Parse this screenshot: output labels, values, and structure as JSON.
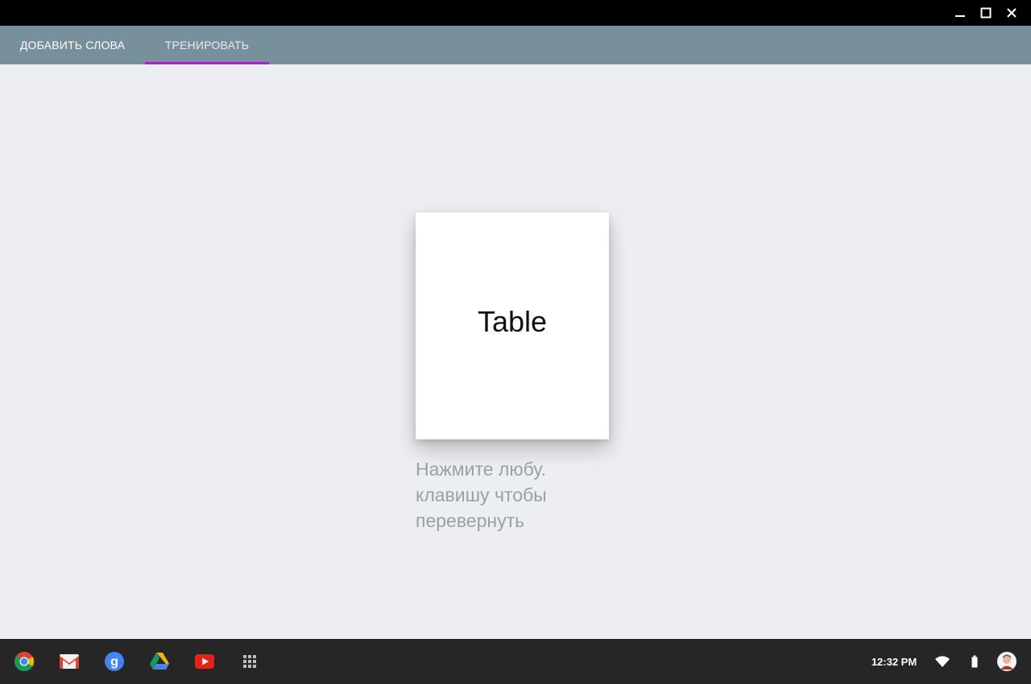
{
  "window": {
    "controls": [
      "minimize-icon",
      "maximize-icon",
      "close-icon"
    ]
  },
  "tabs": [
    {
      "label": "ДОБАВИТЬ СЛОВА"
    },
    {
      "label": "ТРЕНИРОВАТЬ",
      "active": true
    }
  ],
  "colors": {
    "tabbar": "#78909c",
    "tab_indicator": "#d500f9",
    "background": "#eceef1",
    "shelf": "#262626"
  },
  "card": {
    "word": "Table"
  },
  "hint": {
    "lines": [
      "Нажмите любу.",
      "клавишу чтобы",
      "перевернуть"
    ]
  },
  "shelf": {
    "apps": [
      "chrome-icon",
      "gmail-icon",
      "google-search-icon",
      "drive-icon",
      "youtube-icon",
      "app-launcher-icon"
    ],
    "clock": "12:32 PM",
    "tray": [
      "wifi-icon",
      "battery-icon",
      "user-avatar"
    ]
  }
}
